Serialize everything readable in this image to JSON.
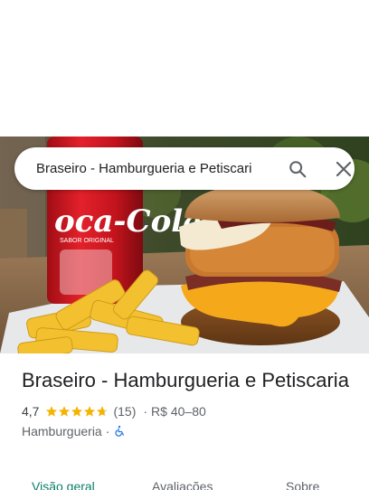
{
  "search": {
    "query": "Braseiro - Hamburgueria e Petiscari"
  },
  "place": {
    "name": "Braseiro - Hamburgueria e Petiscaria",
    "rating": "4,7",
    "stars": 4.7,
    "review_count": "(15)",
    "separator": "·",
    "price_range": "R$ 40–80",
    "category": "Hamburgueria",
    "category_separator": "·"
  },
  "tabs": [
    {
      "label": "Visão geral",
      "active": true
    },
    {
      "label": "Avaliações",
      "active": false
    },
    {
      "label": "Sobre",
      "active": false
    }
  ],
  "photo": {
    "can_brand": "Coca-Cola",
    "can_subtext": "SABOR ORIGINAL"
  },
  "colors": {
    "accent": "#0b7f6b",
    "star": "#f4b400",
    "wheelchair": "#1a73e8"
  }
}
